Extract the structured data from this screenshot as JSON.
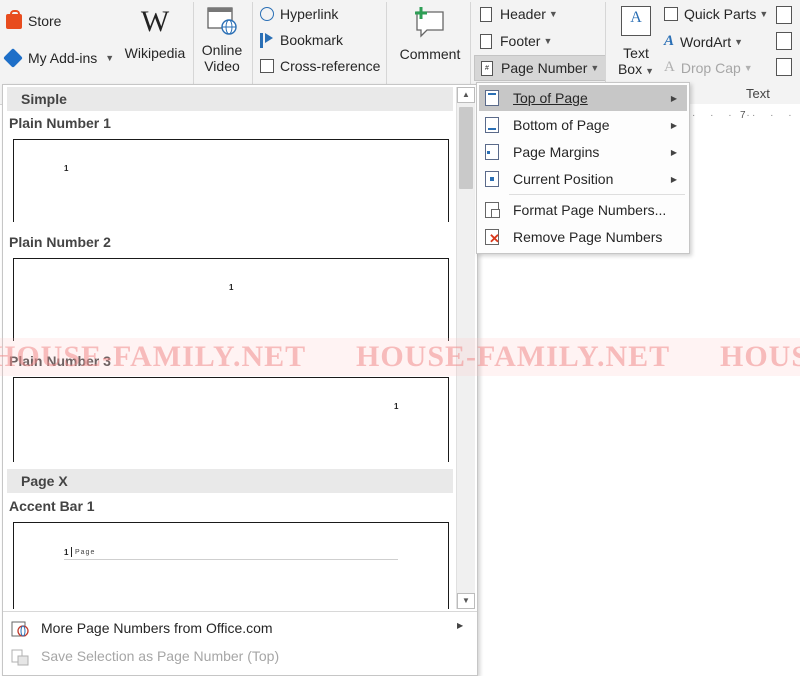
{
  "ribbon": {
    "store": "Store",
    "my_addins": "My Add-ins",
    "wikipedia": "Wikipedia",
    "online_video_1": "Online",
    "online_video_2": "Video",
    "hyperlink": "Hyperlink",
    "bookmark": "Bookmark",
    "cross_reference": "Cross-reference",
    "comment": "Comment",
    "header": "Header",
    "footer": "Footer",
    "page_number": "Page Number",
    "text_box_1": "Text",
    "text_box_2": "Box",
    "quick_parts": "Quick Parts",
    "wordart": "WordArt",
    "drop_cap": "Drop Cap",
    "text_group_label": "Text"
  },
  "ruler": {
    "mark": "7"
  },
  "gallery": {
    "section_simple": "Simple",
    "plain_number_1": "Plain Number 1",
    "plain_number_2": "Plain Number 2",
    "plain_number_3": "Plain Number 3",
    "section_page_x": "Page X",
    "accent_bar_1": "Accent Bar 1",
    "thumb_num": "1",
    "accent_text": "Page",
    "more_numbers": "More Page Numbers from Office.com",
    "save_selection": "Save Selection as Page Number (Top)"
  },
  "submenu": {
    "top_of_page": "Top of Page",
    "bottom_of_page": "Bottom of Page",
    "page_margins": "Page Margins",
    "current_position": "Current Position",
    "format_page_numbers": "Format Page Numbers...",
    "remove_page_numbers": "Remove Page Numbers"
  },
  "watermark": {
    "text": "HOUSE-FAMILY.NET"
  },
  "colors": {
    "store_icon": "#e84c1e",
    "addins_icon": "#1e6fc8",
    "remove_x": "#d9371a",
    "highlight": "#c7c7c7"
  }
}
